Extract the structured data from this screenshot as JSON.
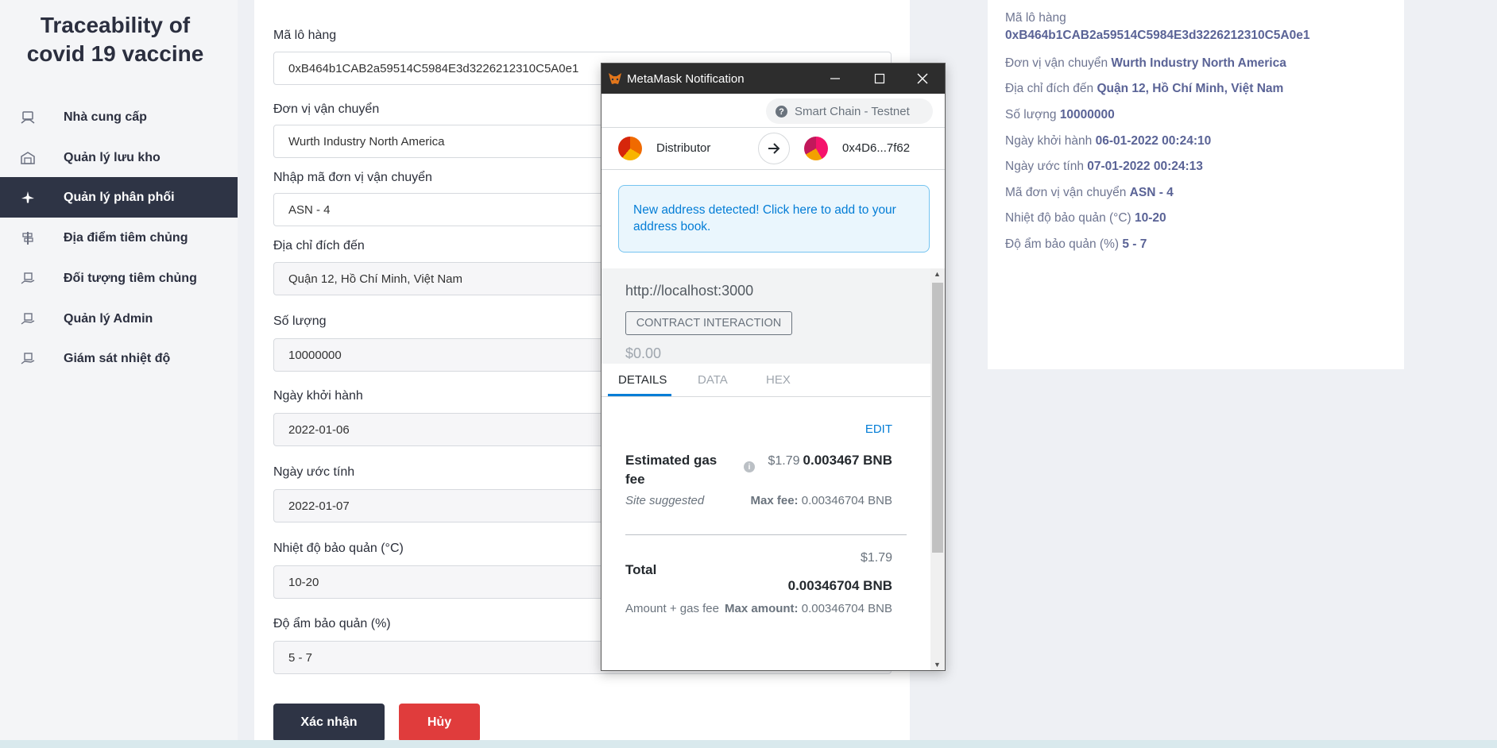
{
  "sidebar": {
    "brand_line1": "Traceability of",
    "brand_line2": "covid 19 vaccine",
    "items": [
      {
        "label": "Nhà cung cấp"
      },
      {
        "label": "Quản lý lưu kho"
      },
      {
        "label": "Quản lý phân phối"
      },
      {
        "label": "Địa điểm tiêm chủng"
      },
      {
        "label": "Đối tượng tiêm chủng"
      },
      {
        "label": "Quản lý Admin"
      },
      {
        "label": "Giám sát nhiệt độ"
      }
    ],
    "active_index": 2
  },
  "form": {
    "fields": [
      {
        "label": "Mã lô hàng",
        "value": "0xB464b1CAB2a59514C5984E3d3226212310C5A0e1"
      },
      {
        "label": "Đơn vị vận chuyển",
        "value": "Wurth Industry North America"
      },
      {
        "label": "Nhập mã đơn vị vận chuyển",
        "value": "ASN - 4"
      },
      {
        "label": "Địa chỉ đích đến",
        "value": "Quận 12, Hồ Chí Minh, Việt Nam"
      },
      {
        "label": "Số lượng",
        "value": "10000000"
      },
      {
        "label": "Ngày khởi hành",
        "value": "2022-01-06"
      },
      {
        "label": "Ngày ước tính",
        "value": "2022-01-07"
      },
      {
        "label": "Nhiệt độ bảo quản (°C)",
        "value": "10-20"
      },
      {
        "label": "Độ ẩm bảo quản (%)",
        "value": "5 - 7"
      }
    ],
    "confirm_label": "Xác nhận",
    "cancel_label": "Hủy"
  },
  "info": {
    "rows": [
      {
        "label": "Mã lô hàng",
        "value": "0xB464b1CAB2a59514C5984E3d3226212310C5A0e1"
      },
      {
        "label": "Đơn vị vận chuyển",
        "value": "Wurth Industry North America"
      },
      {
        "label": "Địa chỉ đích đến",
        "value": "Quận 12, Hồ Chí Minh, Việt Nam"
      },
      {
        "label": "Số lượng",
        "value": "10000000"
      },
      {
        "label": "Ngày khởi hành",
        "value": "06-01-2022 00:24:10"
      },
      {
        "label": "Ngày ước tính",
        "value": "07-01-2022 00:24:13"
      },
      {
        "label": "Mã đơn vị vận chuyển",
        "value": "ASN - 4"
      },
      {
        "label": "Nhiệt độ bảo quản (°C)",
        "value": "10-20"
      },
      {
        "label": "Độ ẩm bảo quản (%)",
        "value": "5 - 7"
      }
    ]
  },
  "metamask": {
    "window_title": "MetaMask Notification",
    "network": "Smart Chain - Testnet",
    "from_account": "Distributor",
    "to_account": "0x4D6...7f62",
    "alert": "New address detected! Click here to add to your address book.",
    "origin": "http://localhost:3000",
    "badge": "CONTRACT INTERACTION",
    "amount": "$0.00",
    "tabs": [
      "DETAILS",
      "DATA",
      "HEX"
    ],
    "edit_label": "EDIT",
    "gas_title": "Estimated gas fee",
    "gas_usd": "$1.79",
    "gas_bnb": "0.003467 BNB",
    "site_suggested": "Site suggested",
    "max_fee_label": "Max fee:",
    "max_fee_value": "0.00346704 BNB",
    "total_label": "Total",
    "total_usd": "$1.79",
    "total_bnb": "0.00346704 BNB",
    "amount_gas_label": "Amount + gas fee",
    "max_amount_label": "Max amount:",
    "max_amount_value": "0.00346704 BNB"
  }
}
